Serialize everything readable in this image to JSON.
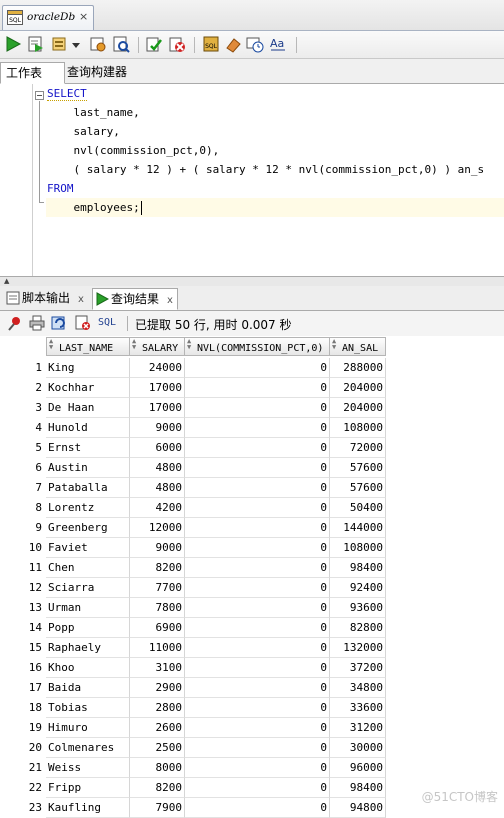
{
  "document_tab": {
    "title": "oracleDb",
    "close_label": "×"
  },
  "worksheet_tabs": [
    {
      "label": "工作表"
    },
    {
      "label": "查询构建器"
    }
  ],
  "editor": {
    "lines": [
      "SELECT",
      "    last_name,",
      "    salary,",
      "    nvl(commission_pct,0),",
      "    ( salary * 12 ) + ( salary * 12 * nvl(commission_pct,0) ) an_s",
      "FROM",
      "    employees;"
    ]
  },
  "output_tabs": [
    {
      "label": "脚本输出",
      "close": "x"
    },
    {
      "label": "查询结果",
      "close": "x"
    }
  ],
  "result_toolbar": {
    "sql_label": "SQL",
    "status": "已提取 50 行, 用时 0.007 秒"
  },
  "grid": {
    "columns": [
      "LAST_NAME",
      "SALARY",
      "NVL(COMMISSION_PCT,0)",
      "AN_SAL"
    ],
    "rows": [
      {
        "n": "1",
        "name": "King",
        "salary": "24000",
        "nvl": "0",
        "an_sal": "288000"
      },
      {
        "n": "2",
        "name": "Kochhar",
        "salary": "17000",
        "nvl": "0",
        "an_sal": "204000"
      },
      {
        "n": "3",
        "name": "De Haan",
        "salary": "17000",
        "nvl": "0",
        "an_sal": "204000"
      },
      {
        "n": "4",
        "name": "Hunold",
        "salary": "9000",
        "nvl": "0",
        "an_sal": "108000"
      },
      {
        "n": "5",
        "name": "Ernst",
        "salary": "6000",
        "nvl": "0",
        "an_sal": "72000"
      },
      {
        "n": "6",
        "name": "Austin",
        "salary": "4800",
        "nvl": "0",
        "an_sal": "57600"
      },
      {
        "n": "7",
        "name": "Pataballa",
        "salary": "4800",
        "nvl": "0",
        "an_sal": "57600"
      },
      {
        "n": "8",
        "name": "Lorentz",
        "salary": "4200",
        "nvl": "0",
        "an_sal": "50400"
      },
      {
        "n": "9",
        "name": "Greenberg",
        "salary": "12000",
        "nvl": "0",
        "an_sal": "144000"
      },
      {
        "n": "10",
        "name": "Faviet",
        "salary": "9000",
        "nvl": "0",
        "an_sal": "108000"
      },
      {
        "n": "11",
        "name": "Chen",
        "salary": "8200",
        "nvl": "0",
        "an_sal": "98400"
      },
      {
        "n": "12",
        "name": "Sciarra",
        "salary": "7700",
        "nvl": "0",
        "an_sal": "92400"
      },
      {
        "n": "13",
        "name": "Urman",
        "salary": "7800",
        "nvl": "0",
        "an_sal": "93600"
      },
      {
        "n": "14",
        "name": "Popp",
        "salary": "6900",
        "nvl": "0",
        "an_sal": "82800"
      },
      {
        "n": "15",
        "name": "Raphaely",
        "salary": "11000",
        "nvl": "0",
        "an_sal": "132000"
      },
      {
        "n": "16",
        "name": "Khoo",
        "salary": "3100",
        "nvl": "0",
        "an_sal": "37200"
      },
      {
        "n": "17",
        "name": "Baida",
        "salary": "2900",
        "nvl": "0",
        "an_sal": "34800"
      },
      {
        "n": "18",
        "name": "Tobias",
        "salary": "2800",
        "nvl": "0",
        "an_sal": "33600"
      },
      {
        "n": "19",
        "name": "Himuro",
        "salary": "2600",
        "nvl": "0",
        "an_sal": "31200"
      },
      {
        "n": "20",
        "name": "Colmenares",
        "salary": "2500",
        "nvl": "0",
        "an_sal": "30000"
      },
      {
        "n": "21",
        "name": "Weiss",
        "salary": "8000",
        "nvl": "0",
        "an_sal": "96000"
      },
      {
        "n": "22",
        "name": "Fripp",
        "salary": "8200",
        "nvl": "0",
        "an_sal": "98400"
      },
      {
        "n": "23",
        "name": "Kaufling",
        "salary": "7900",
        "nvl": "0",
        "an_sal": "94800"
      }
    ]
  },
  "watermark": "@51CTO博客"
}
